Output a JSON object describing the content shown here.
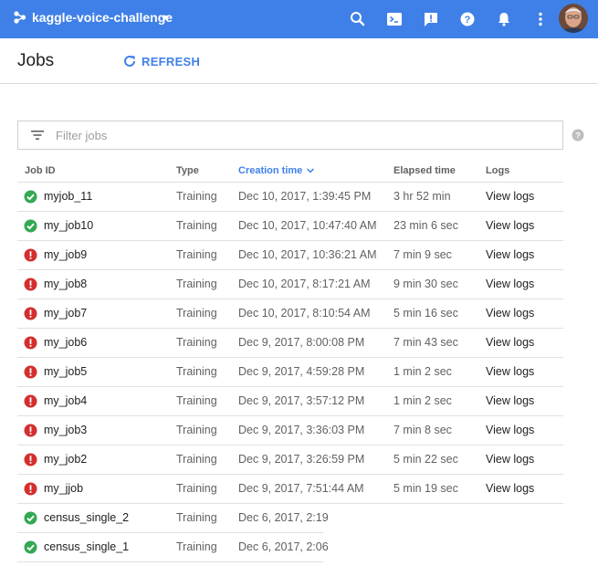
{
  "header": {
    "project_name": "kaggle-voice-challenge",
    "icons": [
      "project-icon",
      "search-icon",
      "cloud-shell-icon",
      "feedback-icon",
      "help-icon",
      "notifications-icon",
      "more-vert-icon",
      "avatar"
    ]
  },
  "page": {
    "title": "Jobs",
    "refresh_label": "REFRESH"
  },
  "filter": {
    "placeholder": "Filter jobs",
    "value": ""
  },
  "table": {
    "columns": {
      "job_id": "Job ID",
      "type": "Type",
      "creation_time": "Creation time",
      "elapsed_time": "Elapsed time",
      "logs": "Logs"
    },
    "sorted_by": "creation_time",
    "rows": [
      {
        "status": "success",
        "job_id": "myjob_11",
        "type": "Training",
        "created": "Dec 10, 2017, 1:39:45 PM",
        "elapsed": "3 hr 52 min",
        "logs": "View logs"
      },
      {
        "status": "success",
        "job_id": "my_job10",
        "type": "Training",
        "created": "Dec 10, 2017, 10:47:40 AM",
        "elapsed": "23 min 6 sec",
        "logs": "View logs"
      },
      {
        "status": "error",
        "job_id": "my_job9",
        "type": "Training",
        "created": "Dec 10, 2017, 10:36:21 AM",
        "elapsed": "7 min 9 sec",
        "logs": "View logs"
      },
      {
        "status": "error",
        "job_id": "my_job8",
        "type": "Training",
        "created": "Dec 10, 2017, 8:17:21 AM",
        "elapsed": "9 min 30 sec",
        "logs": "View logs"
      },
      {
        "status": "error",
        "job_id": "my_job7",
        "type": "Training",
        "created": "Dec 10, 2017, 8:10:54 AM",
        "elapsed": "5 min 16 sec",
        "logs": "View logs"
      },
      {
        "status": "error",
        "job_id": "my_job6",
        "type": "Training",
        "created": "Dec 9, 2017, 8:00:08 PM",
        "elapsed": "7 min 43 sec",
        "logs": "View logs"
      },
      {
        "status": "error",
        "job_id": "my_job5",
        "type": "Training",
        "created": "Dec 9, 2017, 4:59:28 PM",
        "elapsed": "1 min 2 sec",
        "logs": "View logs"
      },
      {
        "status": "error",
        "job_id": "my_job4",
        "type": "Training",
        "created": "Dec 9, 2017, 3:57:12 PM",
        "elapsed": "1 min 2 sec",
        "logs": "View logs"
      },
      {
        "status": "error",
        "job_id": "my_job3",
        "type": "Training",
        "created": "Dec 9, 2017, 3:36:03 PM",
        "elapsed": "7 min 8 sec",
        "logs": "View logs"
      },
      {
        "status": "error",
        "job_id": "my_job2",
        "type": "Training",
        "created": "Dec 9, 2017, 3:26:59 PM",
        "elapsed": "5 min 22 sec",
        "logs": "View logs"
      },
      {
        "status": "error",
        "job_id": "my_jjob",
        "type": "Training",
        "created": "Dec 9, 2017, 7:51:44 AM",
        "elapsed": "5 min 19 sec",
        "logs": "View logs"
      },
      {
        "status": "success",
        "job_id": "census_single_2",
        "type": "Training",
        "created": "Dec 6, 2017, 2:19",
        "elapsed": "",
        "logs": ""
      },
      {
        "status": "success",
        "job_id": "census_single_1",
        "type": "Training",
        "created": "Dec 6, 2017, 2:06",
        "elapsed": "",
        "logs": ""
      }
    ]
  },
  "colors": {
    "topbar": "#3f80e8",
    "accent": "#3f80e8",
    "success": "#34a853",
    "error": "#d32f2f"
  }
}
